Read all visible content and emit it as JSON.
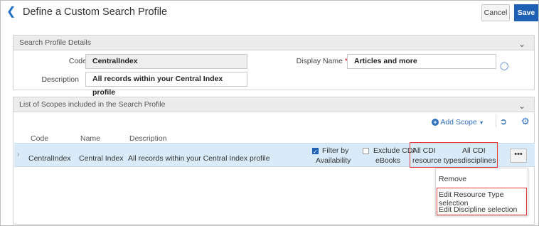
{
  "header": {
    "back_icon": "chevron-left-icon",
    "title": "Define a Custom Search Profile",
    "cancel_label": "Cancel",
    "save_label": "Save"
  },
  "details_panel": {
    "title": "Search Profile Details",
    "code_label": "Code",
    "code_value": "CentralIndex",
    "display_name_label": "Display Name",
    "display_name_value": "Articles and more",
    "description_label": "Description",
    "description_value": "All records within your Central Index profile"
  },
  "scopes_panel": {
    "title": "List of Scopes included in the Search Profile",
    "add_scope_label": "Add Scope",
    "columns": [
      "Code",
      "Name",
      "Description"
    ],
    "row": {
      "code": "CentralIndex",
      "name": "Central Index",
      "description": "All records within your Central Index profile",
      "filter_label_1": "Filter by",
      "filter_label_2": "Availability",
      "exclude_label_1": "Exclude CDI",
      "exclude_label_2": "eBooks",
      "resource_1": "All CDI",
      "resource_2": "resource types",
      "discipline_1": "All CDI",
      "discipline_2": "disciplines",
      "more_label": "•••"
    },
    "menu": {
      "remove": "Remove",
      "edit_resource": "Edit Resource Type selection",
      "edit_discipline": "Edit Discipline selection"
    }
  },
  "colors": {
    "accent": "#1f5fb4",
    "selected_row": "#d9ebf9",
    "highlight_box": "#e53935",
    "required": "#d0021b"
  }
}
